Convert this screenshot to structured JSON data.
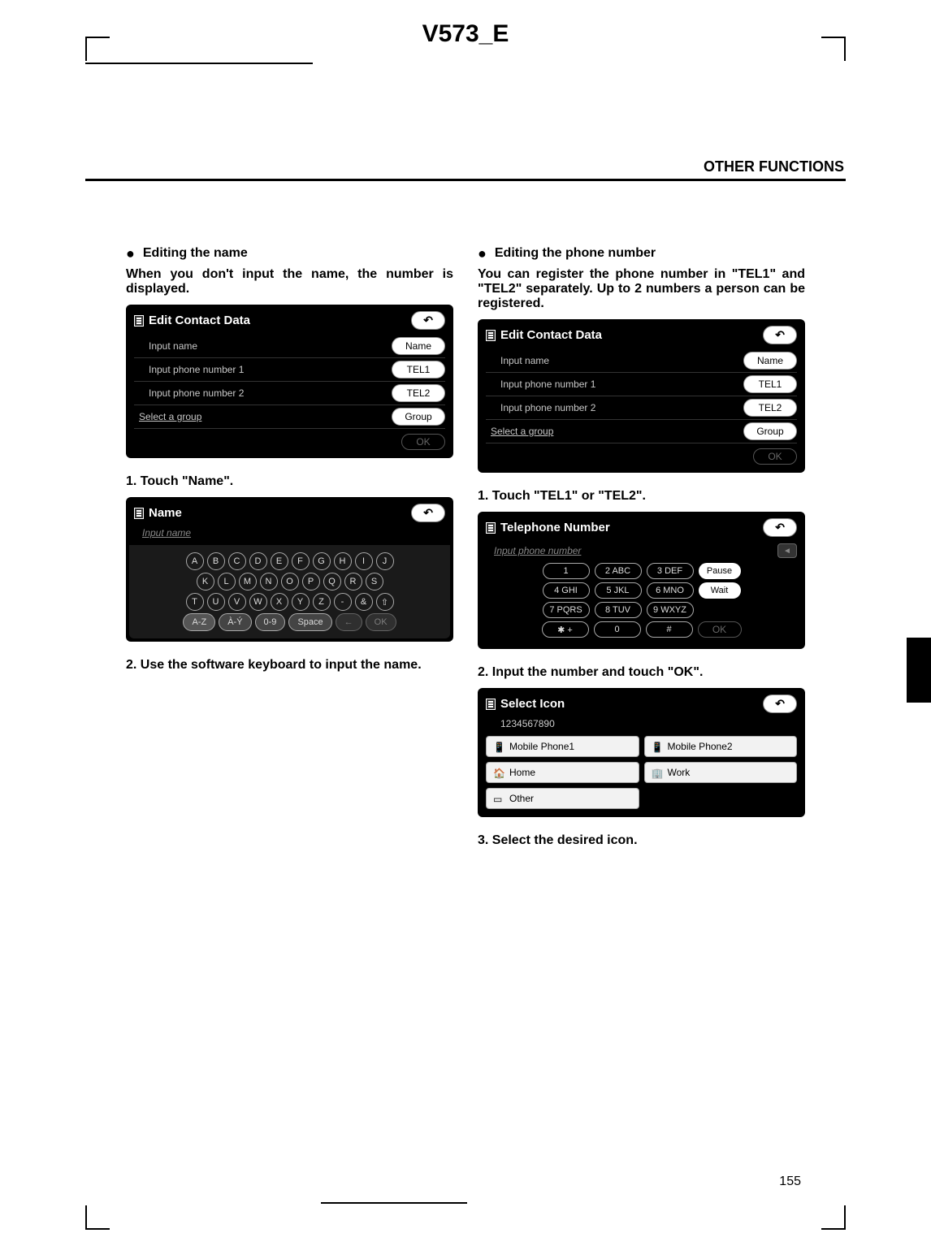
{
  "doc_header": "V573_E",
  "section_header": "OTHER FUNCTIONS",
  "page_number": "155",
  "left": {
    "bullet_title": "Editing the name",
    "intro": "When you don't input the name, the number is displayed.",
    "step1": "1.   Touch \"Name\".",
    "step2": "2.  Use the software keyboard to input the name."
  },
  "right": {
    "bullet_title": "Editing the phone number",
    "intro": "You can register the phone number in \"TEL1\" and \"TEL2\" separately. Up to 2 numbers a person can be registered.",
    "step1": "1.   Touch \"TEL1\" or \"TEL2\".",
    "step2": "2.   Input the number and touch \"OK\".",
    "step3": "3.   Select the desired icon."
  },
  "edit_contact_screen": {
    "title": "Edit Contact Data",
    "rows": [
      {
        "label": "Input name",
        "button": "Name"
      },
      {
        "label": "Input phone number 1",
        "button": "TEL1"
      },
      {
        "label": "Input phone number 2",
        "button": "TEL2"
      },
      {
        "label": "Select a group",
        "button": "Group",
        "underline": true
      }
    ],
    "ok": "OK"
  },
  "name_screen": {
    "title": "Name",
    "hint": "Input name",
    "letters_r1": [
      "A",
      "B",
      "C",
      "D",
      "E",
      "F",
      "G",
      "H",
      "I",
      "J"
    ],
    "letters_r2": [
      "K",
      "L",
      "M",
      "N",
      "O",
      "P",
      "Q",
      "R",
      "S"
    ],
    "letters_r3": [
      "T",
      "U",
      "V",
      "W",
      "X",
      "Y",
      "Z",
      "-",
      "&",
      "⇧"
    ],
    "bottom": {
      "az": "A-Z",
      "ay": "À-Ý",
      "num": "0-9",
      "space": "Space",
      "back": "←",
      "ok": "OK"
    }
  },
  "tel_screen": {
    "title": "Telephone Number",
    "hint": "Input phone number",
    "keys": [
      [
        "1",
        "2 ABC",
        "3 DEF"
      ],
      [
        "4 GHI",
        "5 JKL",
        "6 MNO"
      ],
      [
        "7 PQRS",
        "8 TUV",
        "9 WXYZ"
      ],
      [
        "✱ +",
        "0",
        "#"
      ]
    ],
    "side": [
      "Pause",
      "Wait"
    ],
    "ok": "OK"
  },
  "select_icon_screen": {
    "title": "Select Icon",
    "number": "1234567890",
    "items": [
      "Mobile Phone1",
      "Mobile Phone2",
      "Home",
      "Work",
      "Other"
    ]
  }
}
